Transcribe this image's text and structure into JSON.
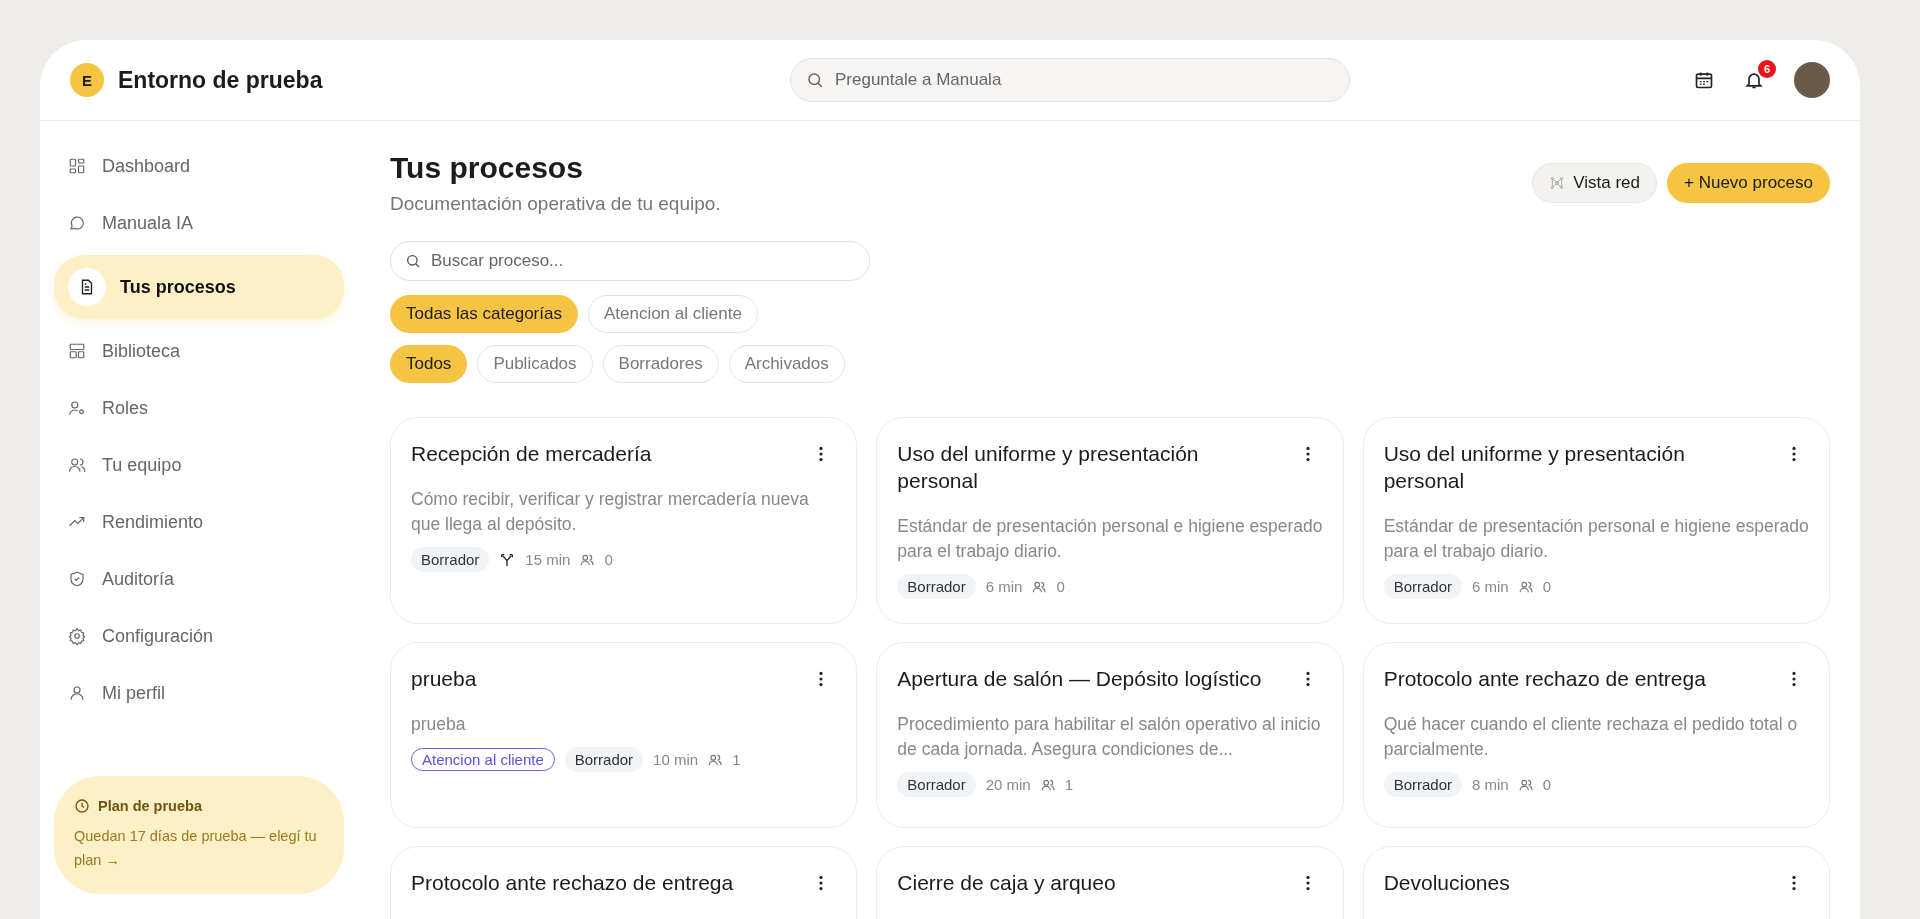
{
  "workspace": {
    "initial": "E",
    "name": "Entorno de prueba"
  },
  "header": {
    "search_placeholder": "Preguntale a Manuala",
    "notifications": "6"
  },
  "sidebar": {
    "items": [
      {
        "label": "Dashboard",
        "selected": false
      },
      {
        "label": "Manuala IA",
        "selected": false
      },
      {
        "label": "Tus procesos",
        "selected": true
      },
      {
        "label": "Biblioteca",
        "selected": false
      },
      {
        "label": "Roles",
        "selected": false
      },
      {
        "label": "Tu equipo",
        "selected": false
      },
      {
        "label": "Rendimiento",
        "selected": false
      },
      {
        "label": "Auditoría",
        "selected": false
      },
      {
        "label": "Configuración",
        "selected": false
      },
      {
        "label": "Mi perfil",
        "selected": false
      }
    ],
    "plan": {
      "title": "Plan de prueba",
      "text": "Quedan 17 días de prueba — elegí tu plan →"
    }
  },
  "main": {
    "title": "Tus procesos",
    "subtitle": "Documentación operativa de tu equipo.",
    "buttons": {
      "network": "Vista red",
      "new": "+ Nuevo proceso"
    },
    "search_placeholder": "Buscar proceso...",
    "categories": [
      {
        "label": "Todas las categorías",
        "selected": true
      },
      {
        "label": "Atencion al cliente",
        "selected": false
      }
    ],
    "statuses": [
      {
        "label": "Todos",
        "selected": true
      },
      {
        "label": "Publicados",
        "selected": false
      },
      {
        "label": "Borradores",
        "selected": false
      },
      {
        "label": "Archivados",
        "selected": false
      }
    ],
    "cards": [
      {
        "title": "Recepción de mercadería",
        "description": "Cómo recibir, verificar y registrar mercadería nueva que llega al depósito.",
        "status": "Borrador",
        "branched": true,
        "duration": "15 min",
        "people": "0"
      },
      {
        "title": "Uso del uniforme y presentación personal",
        "description": "Estándar de presentación personal e higiene esperado para el trabajo diario.",
        "status": "Borrador",
        "branched": false,
        "duration": "6 min",
        "people": "0"
      },
      {
        "title": "Uso del uniforme y presentación personal",
        "description": "Estándar de presentación personal e higiene esperado para el trabajo diario.",
        "status": "Borrador",
        "branched": false,
        "duration": "6 min",
        "people": "0"
      },
      {
        "title": "prueba",
        "description": "prueba",
        "category": "Atencion al cliente",
        "status": "Borrador",
        "branched": false,
        "duration": "10 min",
        "people": "1"
      },
      {
        "title": "Apertura de salón — Depósito logístico",
        "description": "Procedimiento para habilitar el salón operativo al inicio de cada jornada. Asegura condiciones de...",
        "status": "Borrador",
        "branched": false,
        "duration": "20 min",
        "people": "1"
      },
      {
        "title": "Protocolo ante rechazo de entrega",
        "description": "Qué hacer cuando el cliente rechaza el pedido total o parcialmente.",
        "status": "Borrador",
        "branched": false,
        "duration": "8 min",
        "people": "0"
      },
      {
        "title": "Protocolo ante rechazo de entrega"
      },
      {
        "title": "Cierre de caja y arqueo"
      },
      {
        "title": "Devoluciones"
      }
    ]
  }
}
